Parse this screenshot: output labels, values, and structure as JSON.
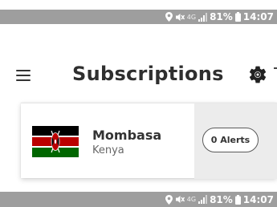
{
  "status_bar": {
    "signal_label": "4G",
    "battery_percent": "81%",
    "time": "14:07"
  },
  "header": {
    "title": "Subscriptions"
  },
  "subscriptions": [
    {
      "city": "Mombasa",
      "country": "Kenya",
      "alerts_label": "0 Alerts"
    }
  ],
  "colors": {
    "status_bar_bg": "#9e9e9e",
    "title_text": "#2f2f2f",
    "alerts_panel_bg": "#ececec",
    "flag_black": "#000000",
    "flag_red": "#bb0000",
    "flag_green": "#006600",
    "flag_white": "#ffffff"
  },
  "icons": {
    "location": "location-icon",
    "mute": "mute-icon",
    "signal": "signal-icon",
    "battery": "battery-icon",
    "menu": "menu-icon",
    "settings": "gear-icon"
  }
}
